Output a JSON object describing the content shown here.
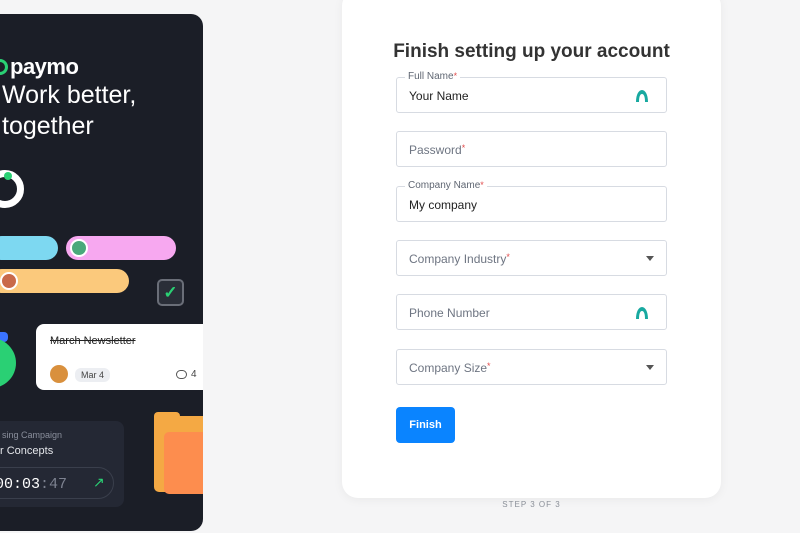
{
  "brand": {
    "name": "paymo",
    "tagline_line1": "Work better,",
    "tagline_line2": "together"
  },
  "illustration": {
    "task_title": "March Newsletter",
    "task_date": "Mar 4",
    "task_comments": "4",
    "timer_subtitle": "sing Campaign",
    "timer_title": "r Concepts",
    "timer_main": "00:03",
    "timer_seconds": ":47"
  },
  "form": {
    "title": "Finish setting up your account",
    "full_name": {
      "label": "Full Name",
      "value": "Your Name"
    },
    "password": {
      "placeholder": "Password"
    },
    "company_name": {
      "label": "Company Name",
      "value": "My company"
    },
    "company_industry": {
      "placeholder": "Company Industry"
    },
    "phone_number": {
      "placeholder": "Phone Number"
    },
    "company_size": {
      "placeholder": "Company Size"
    },
    "required_mark": "*",
    "finish_label": "Finish"
  },
  "step_text": "STEP 3 OF 3",
  "colors": {
    "accent": "#0a84ff",
    "brand_green": "#2ad074",
    "panel_bg": "#1b1e27"
  },
  "icons": {
    "autofill": "password-manager-icon",
    "dropdown": "caret-down-icon"
  }
}
